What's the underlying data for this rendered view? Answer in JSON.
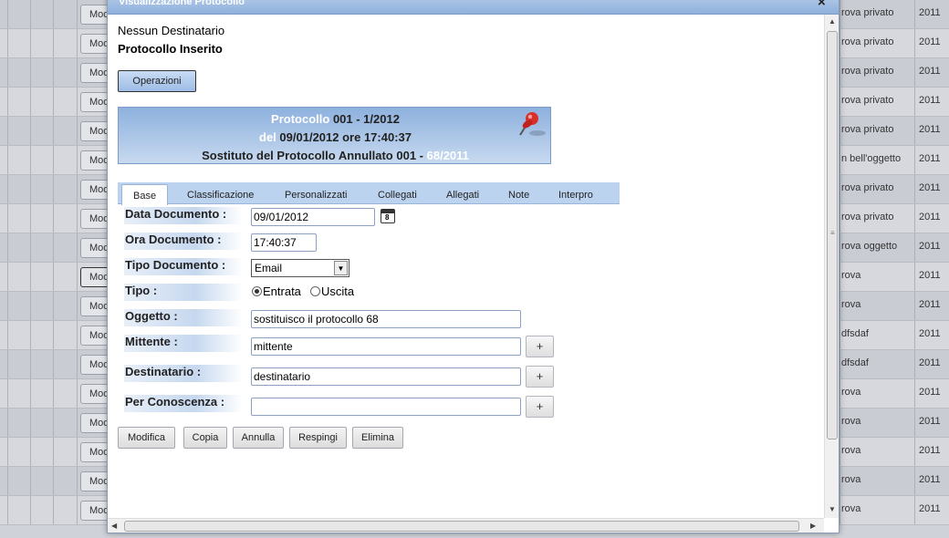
{
  "background_table": {
    "modify_label": "Mod",
    "rows": [
      {
        "object": "rova privato",
        "year": "2011"
      },
      {
        "object": "rova privato",
        "year": "2011"
      },
      {
        "object": "rova privato",
        "year": "2011"
      },
      {
        "object": "rova privato",
        "year": "2011"
      },
      {
        "object": "rova privato",
        "year": "2011"
      },
      {
        "object": "n bell'oggetto",
        "year": "2011"
      },
      {
        "object": "rova privato",
        "year": "2011"
      },
      {
        "object": "rova privato",
        "year": "2011"
      },
      {
        "object": "rova oggetto",
        "year": "2011"
      },
      {
        "object": "rova",
        "year": "2011"
      },
      {
        "object": "rova",
        "year": "2011"
      },
      {
        "object": "dfsdaf",
        "year": "2011"
      },
      {
        "object": "dfsdaf",
        "year": "2011"
      },
      {
        "object": "rova",
        "year": "2011"
      },
      {
        "object": "rova",
        "year": "2011"
      },
      {
        "object": "rova",
        "year": "2011"
      },
      {
        "object": "rova",
        "year": "2011"
      },
      {
        "object": "rova",
        "year": "2011"
      }
    ]
  },
  "dialog": {
    "title": "Visualizzazione Protocollo",
    "close_icon": "close-icon",
    "recipient_status": "Nessun Destinatario",
    "protocol_status": "Protocollo Inserito",
    "operations_label": "Operazioni",
    "header": {
      "protocol_word": "Protocollo",
      "protocol_number": "001 - 1/2012",
      "date_word": "del",
      "date_value": "09/01/2012 ore 17:40:37",
      "substitute_text": "Sostituto del Protocollo Annullato 001 -",
      "substitute_ref": "68/2011",
      "pin_icon": "pushpin-icon"
    },
    "tabs": [
      "Base",
      "Classificazione",
      "Personalizzati",
      "Collegati",
      "Allegati",
      "Note",
      "Interpro"
    ],
    "active_tab": "Base",
    "form": {
      "data_documento_label": "Data Documento :",
      "data_documento_value": "09/01/2012",
      "ora_documento_label": "Ora Documento :",
      "ora_documento_value": "17:40:37",
      "tipo_documento_label": "Tipo Documento :",
      "tipo_documento_value": "Email",
      "tipo_label": "Tipo :",
      "tipo_options": [
        "Entrata",
        "Uscita"
      ],
      "tipo_selected": "Entrata",
      "oggetto_label": "Oggetto :",
      "oggetto_value": "sostituisco il protocollo 68",
      "mittente_label": "Mittente :",
      "mittente_value": "mittente",
      "destinatario_label": "Destinatario :",
      "destinatario_value": "destinatario",
      "per_conoscenza_label": "Per Conoscenza :",
      "per_conoscenza_value": "",
      "plus_label": "+"
    },
    "actions": [
      "Modifica",
      "Copia",
      "Annulla",
      "Respingi",
      "Elimina"
    ]
  }
}
